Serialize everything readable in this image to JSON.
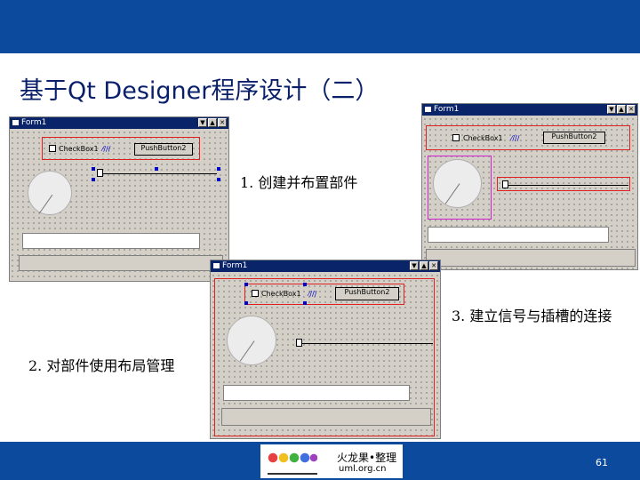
{
  "slide": {
    "title": "基于Qt Designer程序设计（二）",
    "page_number": "61"
  },
  "steps": [
    "1. 创建并布置部件",
    "2. 对部件使用布局管理",
    "3. 建立信号与插槽的连接"
  ],
  "windows": [
    {
      "title": "Form1",
      "checkbox_label": "CheckBox1",
      "button_label": "PushButton2"
    },
    {
      "title": "Form1",
      "checkbox_label": "CheckBox1",
      "button_label": "PushButton2"
    },
    {
      "title": "Form1",
      "checkbox_label": "CheckBox1",
      "button_label": "PushButton2"
    }
  ],
  "window_buttons": {
    "dropdown": "▼",
    "minimize": "▲",
    "close": "✕"
  },
  "icons": [
    "window-icon",
    "dial-icon",
    "slider-icon",
    "logo-icon"
  ],
  "logo": {
    "name": "火龙果•整理",
    "sub": "uml.org.cn"
  },
  "colors": {
    "header": "#0b4a9c",
    "title_text": "#0a1f6a",
    "highlight_red": "#e02020",
    "highlight_magenta": "#d020d0"
  }
}
